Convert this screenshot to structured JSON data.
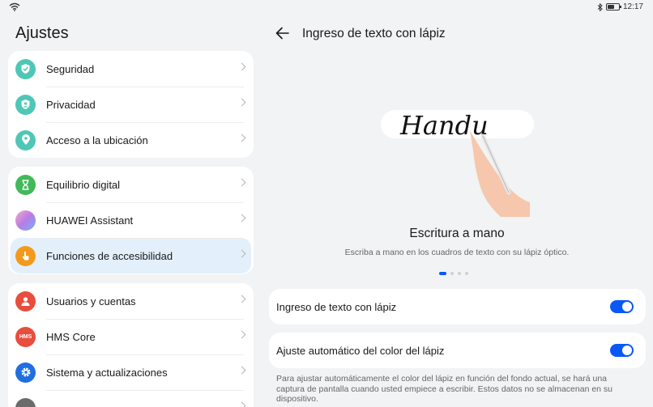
{
  "status_bar": {
    "time": "12:17",
    "battery_level": 0.55,
    "icons": [
      "wifi-icon",
      "bluetooth-icon",
      "battery-icon"
    ]
  },
  "left_pane": {
    "title": "Ajustes",
    "groups": [
      {
        "items": [
          {
            "label": "Seguridad",
            "icon": "shield-check-icon",
            "color": "#4fc7b5"
          },
          {
            "label": "Privacidad",
            "icon": "privacy-shield-icon",
            "color": "#4fc7b5"
          },
          {
            "label": "Acceso a la ubicación",
            "icon": "location-pin-icon",
            "color": "#4fc7b5"
          }
        ]
      },
      {
        "items": [
          {
            "label": "Equilibrio digital",
            "icon": "hourglass-icon",
            "color": "#42b95a"
          },
          {
            "label": "HUAWEI Assistant",
            "icon": "assistant-orb-icon",
            "color": "#b77ce5"
          },
          {
            "label": "Funciones de accesibilidad",
            "icon": "hand-icon",
            "color": "#f39a1e",
            "selected": true
          }
        ]
      },
      {
        "items": [
          {
            "label": "Usuarios y cuentas",
            "icon": "user-icon",
            "color": "#e84d3d"
          },
          {
            "label": "HMS Core",
            "icon": "hms-core-icon",
            "icon_text": "HMS",
            "color": "#e84d3d"
          },
          {
            "label": "Sistema y actualizaciones",
            "icon": "gear-icon",
            "color": "#1f6fe0"
          },
          {
            "label": "",
            "icon": "info-icon",
            "color": "#6b6b6b"
          }
        ]
      }
    ]
  },
  "right_pane": {
    "title": "Ingreso de texto con lápiz",
    "illustration": {
      "handwriting": "Handu"
    },
    "slide": {
      "title": "Escritura a mano",
      "description": "Escriba a mano en los cuadros de texto con su lápiz óptico.",
      "page_count": 4,
      "current_page": 1
    },
    "settings": [
      {
        "label": "Ingreso de texto con lápiz",
        "enabled": true
      },
      {
        "label": "Ajuste automático del color del lápiz",
        "enabled": true
      }
    ],
    "footnote": "Para ajustar automáticamente el color del lápiz en función del fondo actual, se hará una captura de pantalla cuando usted empiece a escribir. Estos datos no se almacenan en su dispositivo."
  },
  "colors": {
    "accent": "#0a59f7",
    "selected_bg": "#e3f0fc",
    "background": "#f1f3f5"
  }
}
